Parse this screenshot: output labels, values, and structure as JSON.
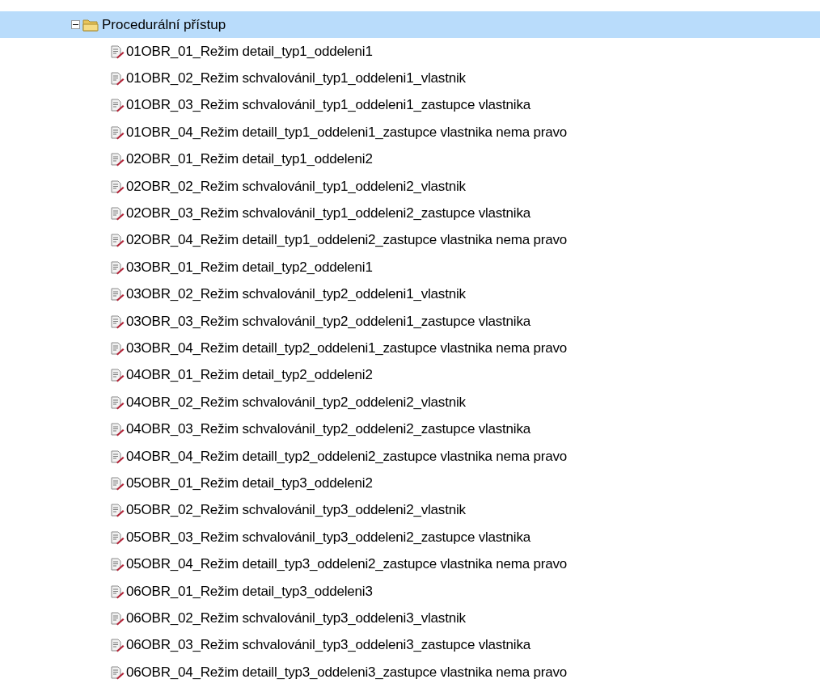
{
  "tree": {
    "label": "Procedurální přístup",
    "expanded": true,
    "selected": true,
    "children": [
      {
        "label": "01OBR_01_Režim detail_typ1_oddeleni1"
      },
      {
        "label": "01OBR_02_Režim schvalovánil_typ1_oddeleni1_vlastnik"
      },
      {
        "label": "01OBR_03_Režim schvalovánil_typ1_oddeleni1_zastupce vlastnika"
      },
      {
        "label": "01OBR_04_Režim detaill_typ1_oddeleni1_zastupce vlastnika nema pravo"
      },
      {
        "label": "02OBR_01_Režim detail_typ1_oddeleni2"
      },
      {
        "label": "02OBR_02_Režim schvalovánil_typ1_oddeleni2_vlastnik"
      },
      {
        "label": "02OBR_03_Režim schvalovánil_typ1_oddeleni2_zastupce vlastnika"
      },
      {
        "label": "02OBR_04_Režim detaill_typ1_oddeleni2_zastupce vlastnika nema pravo"
      },
      {
        "label": "03OBR_01_Režim detail_typ2_oddeleni1"
      },
      {
        "label": "03OBR_02_Režim schvalovánil_typ2_oddeleni1_vlastnik"
      },
      {
        "label": "03OBR_03_Režim schvalovánil_typ2_oddeleni1_zastupce vlastnika"
      },
      {
        "label": "03OBR_04_Režim detaill_typ2_oddeleni1_zastupce vlastnika nema pravo"
      },
      {
        "label": "04OBR_01_Režim detail_typ2_oddeleni2"
      },
      {
        "label": "04OBR_02_Režim schvalovánil_typ2_oddeleni2_vlastnik"
      },
      {
        "label": "04OBR_03_Režim schvalovánil_typ2_oddeleni2_zastupce vlastnika"
      },
      {
        "label": "04OBR_04_Režim detaill_typ2_oddeleni2_zastupce vlastnika nema pravo"
      },
      {
        "label": "05OBR_01_Režim detail_typ3_oddeleni2"
      },
      {
        "label": "05OBR_02_Režim schvalovánil_typ3_oddeleni2_vlastnik"
      },
      {
        "label": "05OBR_03_Režim schvalovánil_typ3_oddeleni2_zastupce vlastnika"
      },
      {
        "label": "05OBR_04_Režim detaill_typ3_oddeleni2_zastupce vlastnika nema pravo"
      },
      {
        "label": "06OBR_01_Režim detail_typ3_oddeleni3"
      },
      {
        "label": "06OBR_02_Režim schvalovánil_typ3_oddeleni3_vlastnik"
      },
      {
        "label": "06OBR_03_Režim schvalovánil_typ3_oddeleni3_zastupce vlastnika"
      },
      {
        "label": "06OBR_04_Režim detaill_typ3_oddeleni3_zastupce vlastnika nema pravo"
      }
    ]
  }
}
